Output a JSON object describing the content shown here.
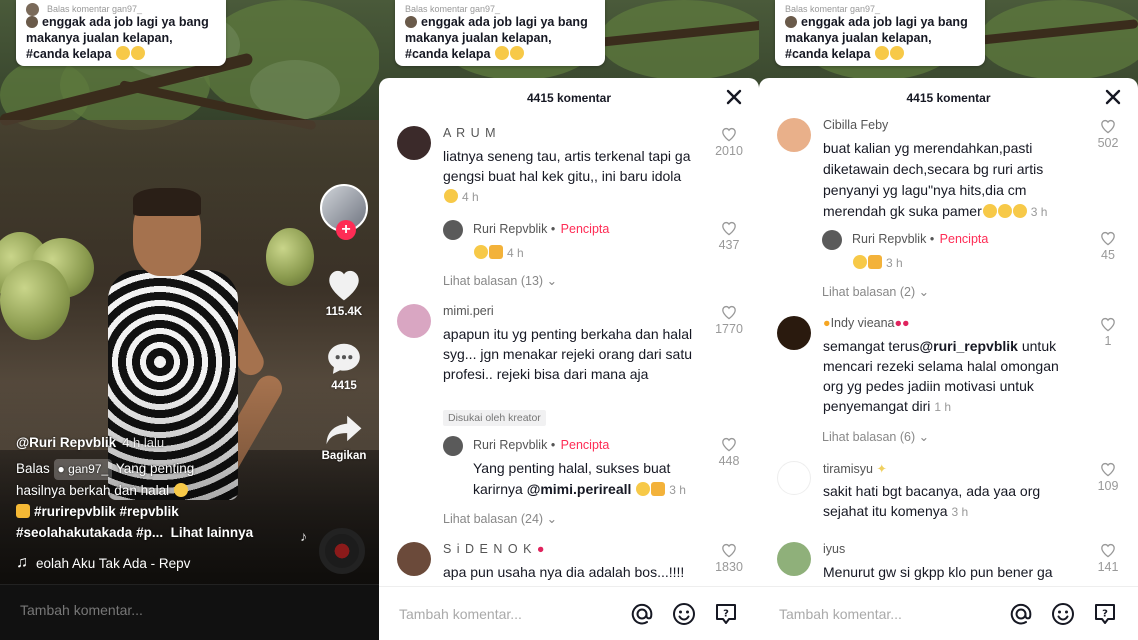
{
  "reply_bubble": {
    "header": "Balas komentar gan97_",
    "text_line1": "enggak ada job lagi ya bang",
    "text_line2": "makanya jualan kelapan,",
    "text_line3": "#canda kelapa"
  },
  "video": {
    "author": "@Ruri Repvblik",
    "time": "4 h lalu",
    "caption_reply_prefix": "Balas",
    "caption_reply_user": "gan97_",
    "caption_text1": "Yang penting",
    "caption_text2": "hasilnya berkah dan halal",
    "hashtags1": "#rurirepvblik #repvblik",
    "hashtags2": "#seolahakutakada #p...",
    "see_more": "Lihat lainnya",
    "music": "eolah Aku Tak Ada - Repv",
    "likes": "115.4K",
    "comments": "4415",
    "share_label": "Bagikan",
    "comment_placeholder": "Tambah komentar..."
  },
  "sheet_middle": {
    "title": "4415 komentar",
    "comments": [
      {
        "name": "A R U M",
        "text": "liatnya seneng tau, artis terkenal tapi ga gengsi buat hal kek gitu,, ini baru idola",
        "time": "4 h",
        "likes": "2010",
        "avatar_color": "#3b2a2a"
      },
      {
        "name": "mimi.peri",
        "text": "apapun itu yg penting berkaha dan halal syg... jgn menakar rejeki orang dari satu profesi.. rejeki bisa dari mana aja",
        "time": "",
        "likes": "1770",
        "avatar_color": "#d9a6c2",
        "badge": "Disukai oleh kreator"
      },
      {
        "name": "S i D E N O K",
        "text": "apa pun usaha nya dia adalah bos...!!!!",
        "likes": "1830",
        "avatar_color": "#6b4a3a"
      }
    ],
    "replies": [
      {
        "name": "Ruri Repvblik",
        "creator": "Pencipta",
        "text": "",
        "time": "4 h",
        "likes": "437"
      },
      {
        "name": "Ruri Repvblik",
        "creator": "Pencipta",
        "text1": "Yang penting halal, sukses buat",
        "text2": "karirnya",
        "mention": "@mimi.perireall",
        "time": "3 h",
        "likes": "448"
      }
    ],
    "view_replies": [
      "Lihat balasan (13)",
      "Lihat balasan (24)"
    ],
    "placeholder": "Tambah komentar..."
  },
  "sheet_right": {
    "title": "4415 komentar",
    "comments": [
      {
        "name": "Cibilla Feby",
        "text": "buat kalian yg merendahkan,pasti diketawain dech,secara bg ruri artis penyanyi yg lagu\"nya hits,dia cm merendah gk suka pamer",
        "time": "3 h",
        "likes": "502",
        "avatar_color": "#e9b08a"
      },
      {
        "name": "Indy vieana",
        "text_pre": "semangat terus",
        "mention": "@ruri_repvblik",
        "text_post": "untuk mencari rezeki selama halal omongan org yg pedes jadiin motivasi untuk penyemangat diri",
        "time": "1 h",
        "likes": "1",
        "avatar_color": "#2a1a0e"
      },
      {
        "name": "tiramisyu",
        "text": "sakit hati bgt bacanya, ada yaa org sejahat itu komenya",
        "time": "3 h",
        "likes": "109",
        "avatar_color": "#ffffff"
      },
      {
        "name": "iyus",
        "text": "Menurut gw si gkpp klo pun bener ga",
        "likes": "141",
        "avatar_color": "#8fb07a"
      }
    ],
    "reply": {
      "name": "Ruri Repvblik",
      "creator": "Pencipta",
      "time": "3 h",
      "likes": "45"
    },
    "view_replies": [
      "Lihat balasan (2)",
      "Lihat balasan (6)"
    ],
    "placeholder": "Tambah komentar..."
  }
}
